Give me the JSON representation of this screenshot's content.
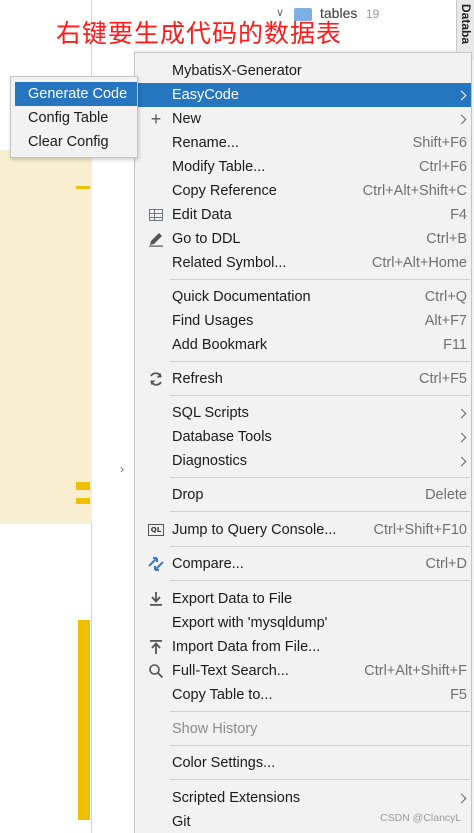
{
  "annotation": "右键要生成代码的数据表",
  "tree": {
    "label": "tables",
    "count": "19"
  },
  "side_panel_title": "Databa",
  "submenu": [
    {
      "label": "Generate Code",
      "active": true
    },
    {
      "label": "Config Table"
    },
    {
      "label": "Clear Config"
    }
  ],
  "menu": {
    "items": {
      "mybatisx": {
        "label": "MybatisX-Generator"
      },
      "easycode": {
        "label": "EasyCode"
      },
      "new": {
        "label": "New"
      },
      "rename": {
        "label": "Rename...",
        "shortcut": "Shift+F6"
      },
      "modify_table": {
        "label": "Modify Table...",
        "shortcut": "Ctrl+F6"
      },
      "copy_reference": {
        "label": "Copy Reference",
        "shortcut": "Ctrl+Alt+Shift+C"
      },
      "edit_data": {
        "label": "Edit Data",
        "shortcut": "F4"
      },
      "go_to_ddl": {
        "label": "Go to DDL",
        "shortcut": "Ctrl+B"
      },
      "related_symbol": {
        "label": "Related Symbol...",
        "shortcut": "Ctrl+Alt+Home"
      },
      "quick_doc": {
        "label": "Quick Documentation",
        "shortcut": "Ctrl+Q"
      },
      "find_usages": {
        "label": "Find Usages",
        "shortcut": "Alt+F7"
      },
      "add_bookmark": {
        "label": "Add Bookmark",
        "shortcut": "F11"
      },
      "refresh": {
        "label": "Refresh",
        "shortcut": "Ctrl+F5"
      },
      "sql_scripts": {
        "label": "SQL Scripts"
      },
      "database_tools": {
        "label": "Database Tools"
      },
      "diagnostics": {
        "label": "Diagnostics"
      },
      "drop": {
        "label": "Drop",
        "shortcut": "Delete"
      },
      "jump_console": {
        "label": "Jump to Query Console...",
        "shortcut": "Ctrl+Shift+F10"
      },
      "compare": {
        "label": "Compare...",
        "shortcut": "Ctrl+D"
      },
      "export_file": {
        "label": "Export Data to File"
      },
      "export_mysqldump": {
        "label": "Export with 'mysqldump'"
      },
      "import_file": {
        "label": "Import Data from File..."
      },
      "fulltext_search": {
        "label": "Full-Text Search...",
        "shortcut": "Ctrl+Alt+Shift+F"
      },
      "copy_table": {
        "label": "Copy Table to...",
        "shortcut": "F5"
      },
      "show_history": {
        "label": "Show History"
      },
      "color_settings": {
        "label": "Color Settings..."
      },
      "scripted_ext": {
        "label": "Scripted Extensions"
      },
      "git": {
        "label": "Git"
      }
    }
  },
  "icons": {
    "new": "plus-icon",
    "edit_data": "table-icon",
    "go_to_ddl": "pencil-icon",
    "refresh": "refresh-icon",
    "jump_console": "query-console-icon",
    "compare": "compare-arrows-icon",
    "export_file": "download-icon",
    "import_file": "upload-icon",
    "fulltext_search": "search-icon"
  },
  "watermark": "CSDN @ClancyL",
  "colors": {
    "highlight": "#2675bf",
    "annotation": "#ff1a1a",
    "menu_bg": "#f2f2f2"
  }
}
